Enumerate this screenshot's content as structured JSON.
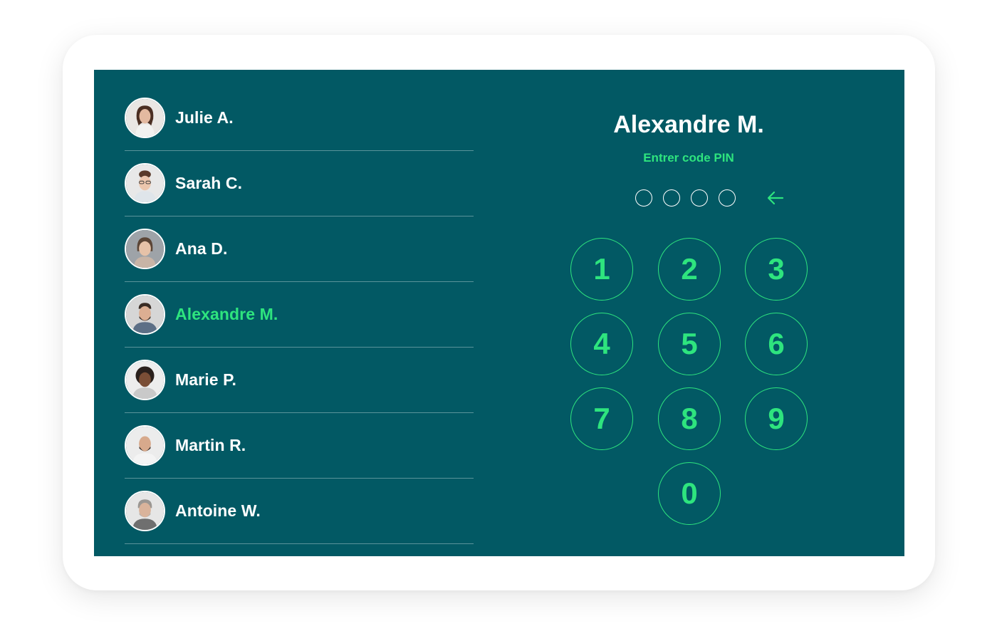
{
  "users": [
    {
      "name": "Julie A.",
      "active": false
    },
    {
      "name": "Sarah C.",
      "active": false
    },
    {
      "name": "Ana D.",
      "active": false
    },
    {
      "name": "Alexandre M.",
      "active": true
    },
    {
      "name": "Marie P.",
      "active": false
    },
    {
      "name": "Martin R.",
      "active": false
    },
    {
      "name": "Antoine W.",
      "active": false
    }
  ],
  "pin": {
    "selected_user": "Alexandre M.",
    "prompt": "Entrer code PIN",
    "digits_entered": 0,
    "digits_total": 4,
    "keys": [
      "1",
      "2",
      "3",
      "4",
      "5",
      "6",
      "7",
      "8",
      "9",
      "0"
    ]
  },
  "colors": {
    "screen_bg": "#025964",
    "accent": "#2ee47e",
    "text": "#ffffff"
  }
}
